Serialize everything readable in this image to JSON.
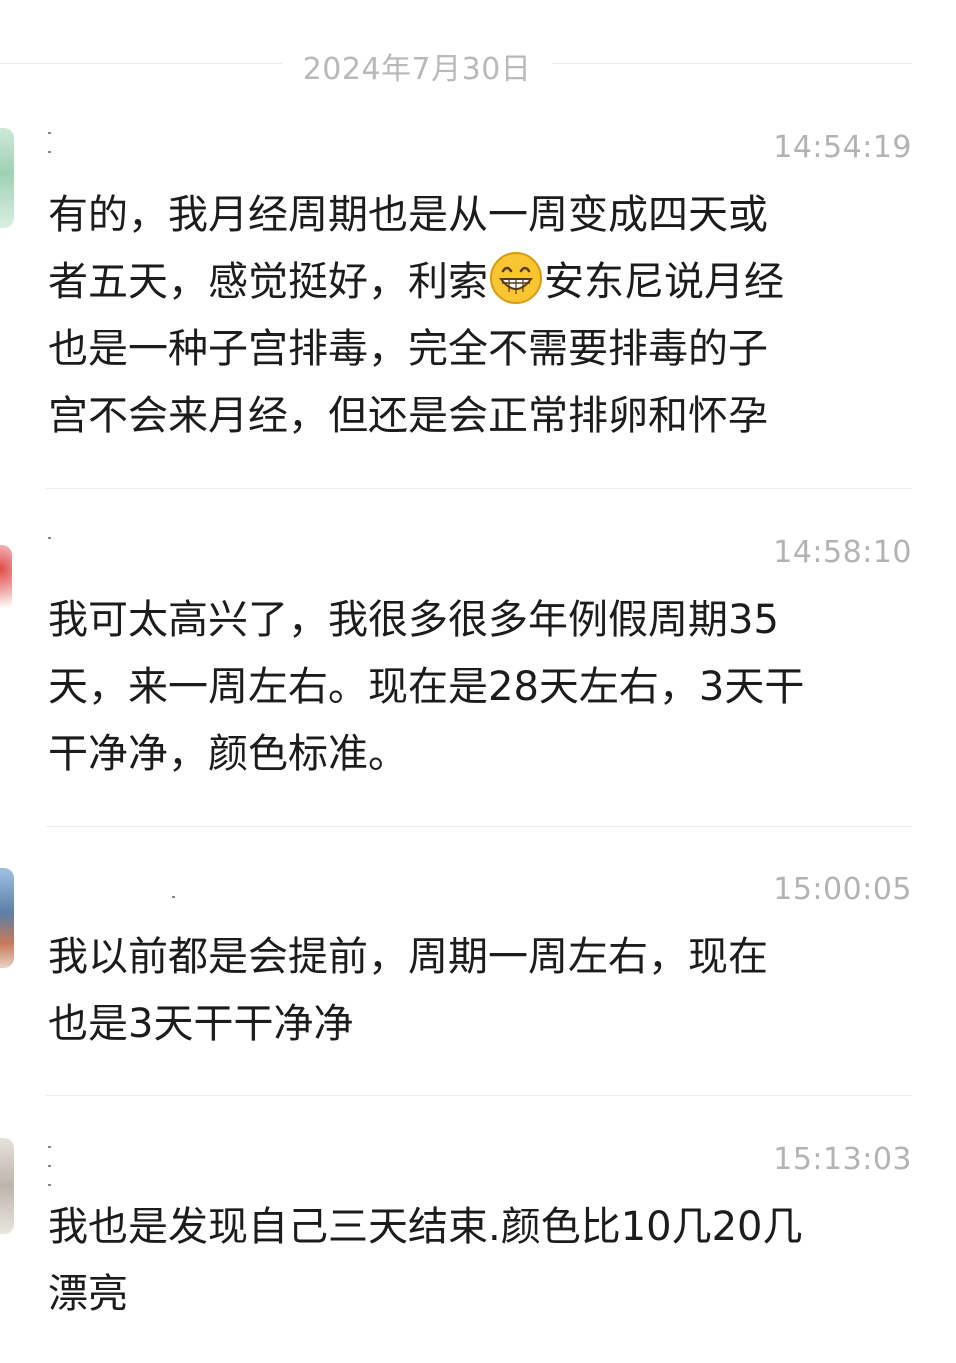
{
  "date_divider": "2024年7月30日",
  "messages": [
    {
      "time": "14:54:19",
      "text_before_emoji": "有的，我月经周期也是从一周变成四天或\n者五天，感觉挺好，利索",
      "emoji": "grinning-face-emoji",
      "text_after_emoji": "安东尼说月经\n也是一种子宫排毒，完全不需要排毒的子\n宫不会来月经，但还是会正常排卵和怀孕"
    },
    {
      "time": "14:58:10",
      "text": "我可太高兴了，我很多很多年例假周期35\n天，来一周左右。现在是28天左右，3天干\n干净净，颜色标准。"
    },
    {
      "time": "15:00:05",
      "text": "我以前都是会提前，周期一周左右，现在\n也是3天干干净净"
    },
    {
      "time": "15:13:03",
      "text": "我也是发现自己三天结束.颜色比10几20几\n漂亮"
    }
  ],
  "colors": {
    "background": "#ffffff",
    "timestamp": "#b3b3b3",
    "message_text": "#1c1c1c",
    "divider": "#ececec",
    "emoji_face": "#f9c531"
  }
}
